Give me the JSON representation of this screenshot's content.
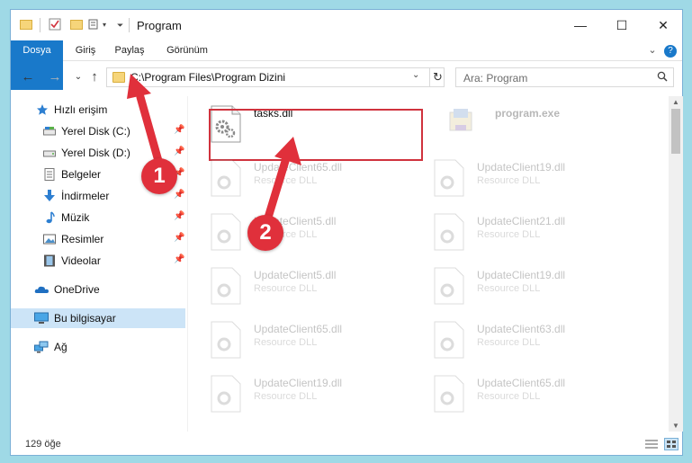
{
  "window": {
    "title": "Program"
  },
  "controls": {
    "minimize": "—",
    "maximize": "☐",
    "close": "✕"
  },
  "ribbon": {
    "tabs": [
      "Dosya",
      "Giriş",
      "Paylaş",
      "Görünüm"
    ],
    "expand": "⌄",
    "help": "?"
  },
  "address": {
    "path": "C:\\Program Files\\Program Dizini",
    "dropdown": "⌄",
    "refresh": "↻"
  },
  "nav_buttons": {
    "back": "←",
    "forward": "→",
    "recent": "⌄",
    "up": "↑"
  },
  "search": {
    "placeholder": "Ara: Program"
  },
  "nav": {
    "quick_access": "Hızlı erişim",
    "items": [
      {
        "label": "Yerel Disk (C:)",
        "icon": "drive-icon",
        "pinned": true
      },
      {
        "label": "Yerel Disk (D:)",
        "icon": "drive-icon",
        "pinned": true
      },
      {
        "label": "Belgeler",
        "icon": "documents-icon",
        "pinned": true
      },
      {
        "label": "İndirmeler",
        "icon": "download-icon",
        "pinned": true
      },
      {
        "label": "Müzik",
        "icon": "music-icon",
        "pinned": true
      },
      {
        "label": "Resimler",
        "icon": "pictures-icon",
        "pinned": true
      },
      {
        "label": "Videolar",
        "icon": "videos-icon",
        "pinned": true
      }
    ],
    "onedrive": "OneDrive",
    "this_pc": "Bu bilgisayar",
    "network": "Ağ"
  },
  "files": {
    "selected": {
      "name": "tasks.dll",
      "type": ""
    },
    "program": {
      "name": "program.exe"
    },
    "faded": [
      {
        "name": "UpdateClient65.dll",
        "type": "Resource DLL"
      },
      {
        "name": "UpdateClient19.dll",
        "type": "Resource DLL"
      },
      {
        "name": "UpdateClient5.dll",
        "type": "Resource DLL"
      },
      {
        "name": "UpdateClient21.dll",
        "type": "Resource DLL"
      },
      {
        "name": "UpdateClient5.dll",
        "type": "Resource DLL"
      },
      {
        "name": "UpdateClient19.dll",
        "type": "Resource DLL"
      },
      {
        "name": "UpdateClient65.dll",
        "type": "Resource DLL"
      },
      {
        "name": "UpdateClient63.dll",
        "type": "Resource DLL"
      },
      {
        "name": "UpdateClient19.dll",
        "type": "Resource DLL"
      },
      {
        "name": "UpdateClient65.dll",
        "type": "Resource DLL"
      }
    ]
  },
  "status": {
    "count": "129 öğe"
  },
  "callouts": [
    "1",
    "2"
  ],
  "colors": {
    "accent": "#1979ca",
    "callout": "#e0303b",
    "selection": "#cce4f7"
  }
}
